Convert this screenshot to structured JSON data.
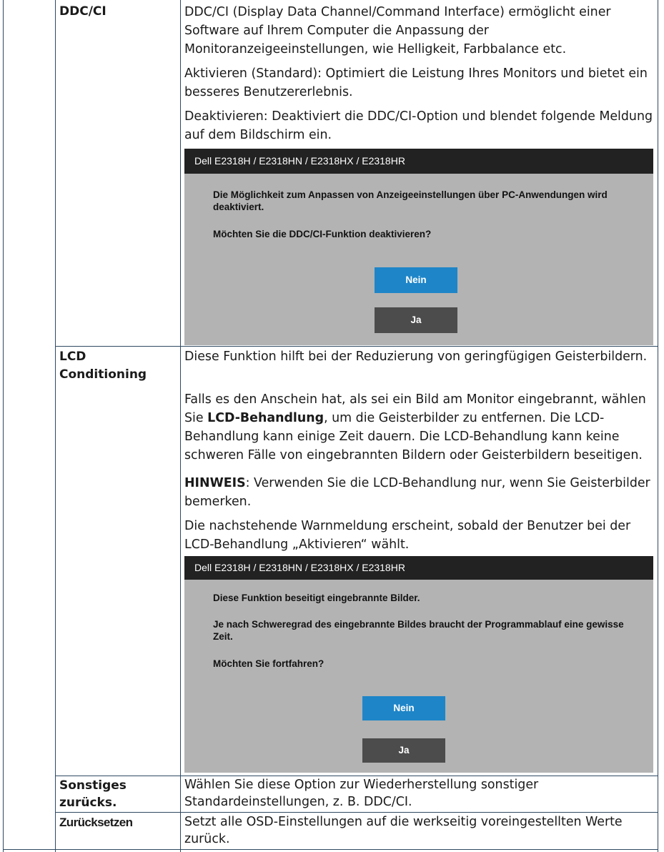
{
  "rows": {
    "ddc": {
      "label": "DDC/CI",
      "paragraphs": [
        "DDC/CI (Display Data Channel/Command Interface) ermöglicht einer Software auf Ihrem Computer die Anpassung der Monitoranzeigeeinstellungen, wie Helligkeit, Farbbalance etc.",
        "Aktivieren (Standard): Optimiert die Leistung Ihres Monitors und bietet ein besseres Benutzererlebnis.",
        "Deaktivieren: Deaktiviert die DDC/CI-Option und blendet folgende Meldung auf dem Bildschirm ein."
      ],
      "dialog": {
        "title": "Dell  E2318H / E2318HN / E2318HX / E2318HR",
        "message_1": "Die Möglichkeit zum Anpassen von Anzeigeeinstellungen über PC-Anwendungen wird deaktiviert.",
        "message_2": "Möchten Sie die DDC/CI-Funktion deaktivieren?",
        "no_label": "Nein",
        "yes_label": "Ja"
      }
    },
    "lcd": {
      "label_1": "LCD",
      "label_2": "Conditioning",
      "p1": "Diese Funktion hilft bei der Reduzierung von geringfügigen Geisterbildern.",
      "p2_before": "Falls es den Anschein hat, als sei ein Bild am Monitor eingebrannt, wählen Sie ",
      "p2_bold": "LCD-Behandlung",
      "p2_after": ", um die Geisterbilder zu entfernen. Die LCD-Behandlung kann einige Zeit dauern. Die LCD-Behandlung kann keine schweren Fälle von eingebrannten Bildern oder Geisterbildern beseitigen.",
      "p3_bold": "HINWEIS",
      "p3_after": ": Verwenden Sie die LCD-Behandlung nur, wenn Sie Geisterbilder bemerken.",
      "p4": "Die nachstehende Warnmeldung erscheint, sobald der Benutzer bei der LCD-Behandlung „Aktivieren“ wählt.",
      "dialog": {
        "title": "Dell  E2318H / E2318HN / E2318HX / E2318HR",
        "message_1": "Diese Funktion beseitigt eingebrannte Bilder.",
        "message_2": "Je nach Schweregrad des eingebrannte Bildes braucht der Programmablauf eine gewisse Zeit.",
        "message_3": "Möchten Sie fortfahren?",
        "no_label": "Nein",
        "yes_label": "Ja"
      }
    },
    "other_reset": {
      "label_1": "Sonstiges",
      "label_2": "zurücks.",
      "text": "Wählen Sie diese Option zur Wiederherstellung sonstiger Standardeinstellungen, z. B. DDC/CI."
    },
    "factory_reset": {
      "label": "Zurücksetzen",
      "text": "Setzt alle OSD-Einstellungen auf die werkseitig voreingestellten Werte zurück."
    }
  }
}
